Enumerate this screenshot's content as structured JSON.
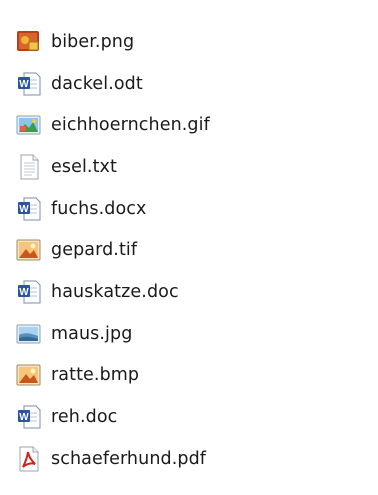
{
  "files": [
    {
      "name": "biber.png",
      "icon": "png-image-icon"
    },
    {
      "name": "dackel.odt",
      "icon": "word-document-icon"
    },
    {
      "name": "eichhoernchen.gif",
      "icon": "gif-image-icon"
    },
    {
      "name": "esel.txt",
      "icon": "text-file-icon"
    },
    {
      "name": "fuchs.docx",
      "icon": "word-document-icon"
    },
    {
      "name": "gepard.tif",
      "icon": "tif-image-icon"
    },
    {
      "name": "hauskatze.doc",
      "icon": "word-document-icon"
    },
    {
      "name": "maus.jpg",
      "icon": "jpg-image-icon"
    },
    {
      "name": "ratte.bmp",
      "icon": "bmp-image-icon"
    },
    {
      "name": "reh.doc",
      "icon": "word-document-icon"
    },
    {
      "name": "schaeferhund.pdf",
      "icon": "pdf-document-icon"
    }
  ]
}
